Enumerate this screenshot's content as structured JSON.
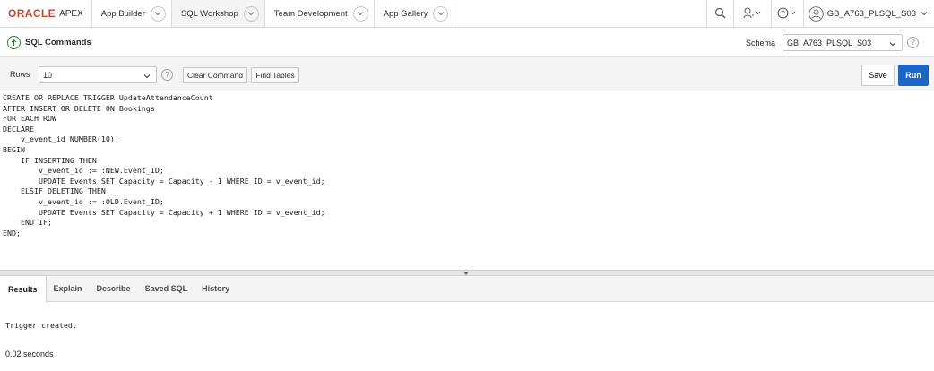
{
  "brand": {
    "oracle": "ORACLE",
    "apex": "APEX"
  },
  "nav": {
    "tabs": [
      {
        "label": "App Builder"
      },
      {
        "label": "SQL Workshop"
      },
      {
        "label": "Team Development"
      },
      {
        "label": "App Gallery"
      }
    ],
    "user": "GB_A763_PLSQL_S03",
    "icons": [
      "search-icon",
      "user-admin-icon",
      "help-icon",
      "user-avatar-icon"
    ]
  },
  "page": {
    "title": "SQL Commands",
    "schema_label": "Schema",
    "schema_value": "GB_A763_PLSQL_S03"
  },
  "toolbar": {
    "rows_label": "Rows",
    "rows_value": "10",
    "clear_label": "Clear Command",
    "find_label": "Find Tables",
    "save_label": "Save",
    "run_label": "Run"
  },
  "editor": {
    "code": "CREATE OR REPLACE TRIGGER UpdateAttendanceCount\nAFTER INSERT OR DELETE ON Bookings\nFOR EACH ROW\nDECLARE\n    v_event_id NUMBER(10);\nBEGIN\n    IF INSERTING THEN\n        v_event_id := :NEW.Event_ID;\n        UPDATE Events SET Capacity = Capacity - 1 WHERE ID = v_event_id;\n    ELSIF DELETING THEN\n        v_event_id := :OLD.Event_ID;\n        UPDATE Events SET Capacity = Capacity + 1 WHERE ID = v_event_id;\n    END IF;\nEND;"
  },
  "results": {
    "tabs": [
      {
        "label": "Results"
      },
      {
        "label": "Explain"
      },
      {
        "label": "Describe"
      },
      {
        "label": "Saved SQL"
      },
      {
        "label": "History"
      }
    ],
    "message": "Trigger created.",
    "time": "0.02 seconds"
  }
}
